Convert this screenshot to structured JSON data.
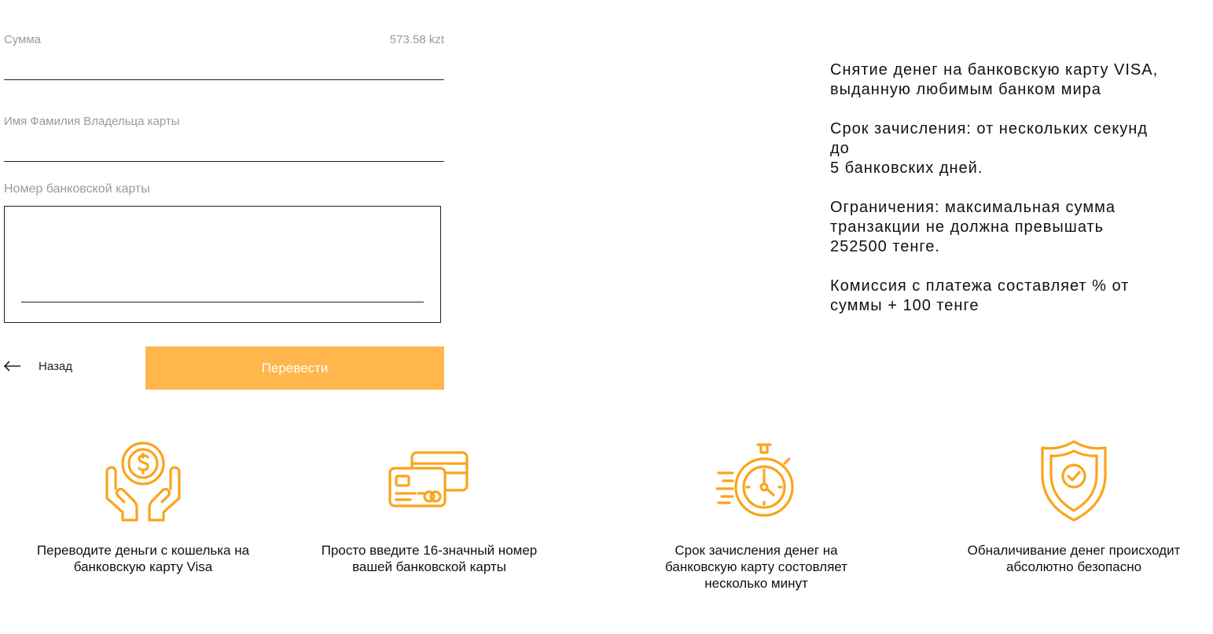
{
  "form": {
    "amount_label": "Сумма",
    "amount_value": "573.58 kzt",
    "name_label": "Имя Фамилия Владельца карты",
    "name_value": "",
    "card_label": "Номер банковской карты",
    "card_value": "",
    "back_label": "Назад",
    "submit_label": "Перевести"
  },
  "info": {
    "p1": "Снятие денег на банковскую карту VISA,\nвыданную любимым банком мира",
    "p2": "Срок зачисления: от нескольких секунд\nдо\n5 банковских дней.",
    "p3": "Ограничения: максимальная сумма\nтранзакции не должна превышать\n252500 тенге.",
    "p4": "Комиссия с платежа составляет % от\nсуммы + 100 тенге"
  },
  "features": [
    {
      "icon": "hands-coin-icon",
      "text": "Переводите деньги с кошелька на банковскую карту Visa"
    },
    {
      "icon": "credit-cards-icon",
      "text": "Просто введите 16-значный номер вашей банковской карты"
    },
    {
      "icon": "stopwatch-icon",
      "text": "Срок зачисления денег на банковскую карту состовляет несколько минут"
    },
    {
      "icon": "shield-check-icon",
      "text": "Обналичивание денег происходит абсолютно безопасно"
    }
  ],
  "colors": {
    "accent": "#ffb74d",
    "icon": "#fba41b",
    "label": "#9a9a9a"
  }
}
